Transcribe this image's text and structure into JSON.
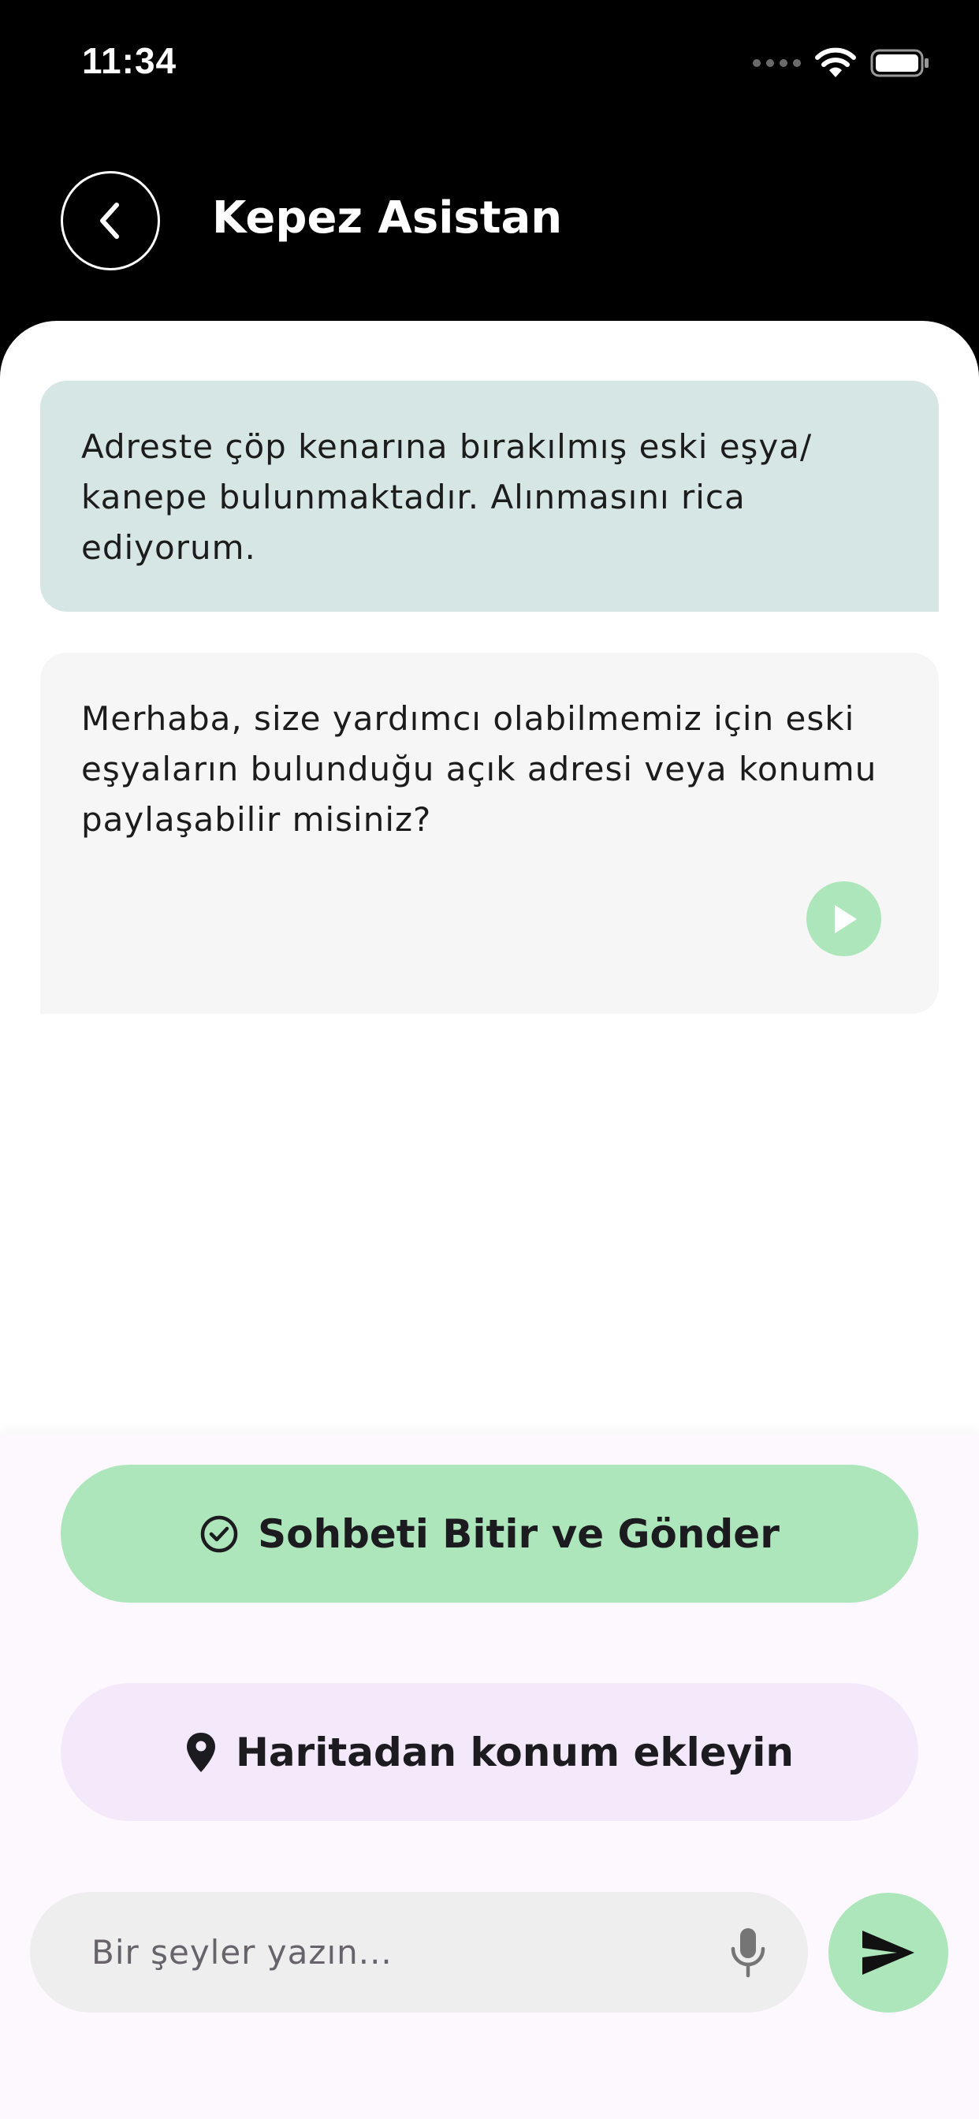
{
  "status_bar": {
    "time": "11:34"
  },
  "header": {
    "title": "Kepez Asistan",
    "back_icon": "chevron-left-icon"
  },
  "messages": [
    {
      "role": "user",
      "text": "Adreste çöp kenarına bırakılmış eski eşya/ kanepe bulunmaktadır. Alınmasını rica ediyorum."
    },
    {
      "role": "assistant",
      "text": "Merhaba, size yardımcı olabilmemiz için eski eşyaların bulunduğu açık adresi veya konumu paylaşabilir misiniz?",
      "play_icon": "play-icon"
    }
  ],
  "actions": {
    "finish_label": "Sohbeti Bitir ve Gönder",
    "finish_icon": "check-circle-icon",
    "location_label": "Haritadan konum ekleyin",
    "location_icon": "location-pin-icon"
  },
  "composer": {
    "placeholder": "Bir şeyler yazın...",
    "value": "",
    "mic_icon": "microphone-icon",
    "send_icon": "send-icon"
  },
  "colors": {
    "header_bg": "#000000",
    "user_bubble": "#d6e6e5",
    "assistant_bubble": "#f6f6f6",
    "accent_green": "#ade6bb",
    "location_button": "#f4e9fb",
    "panel_bg": "#fdf7fe",
    "input_bg": "#eeeeee"
  }
}
